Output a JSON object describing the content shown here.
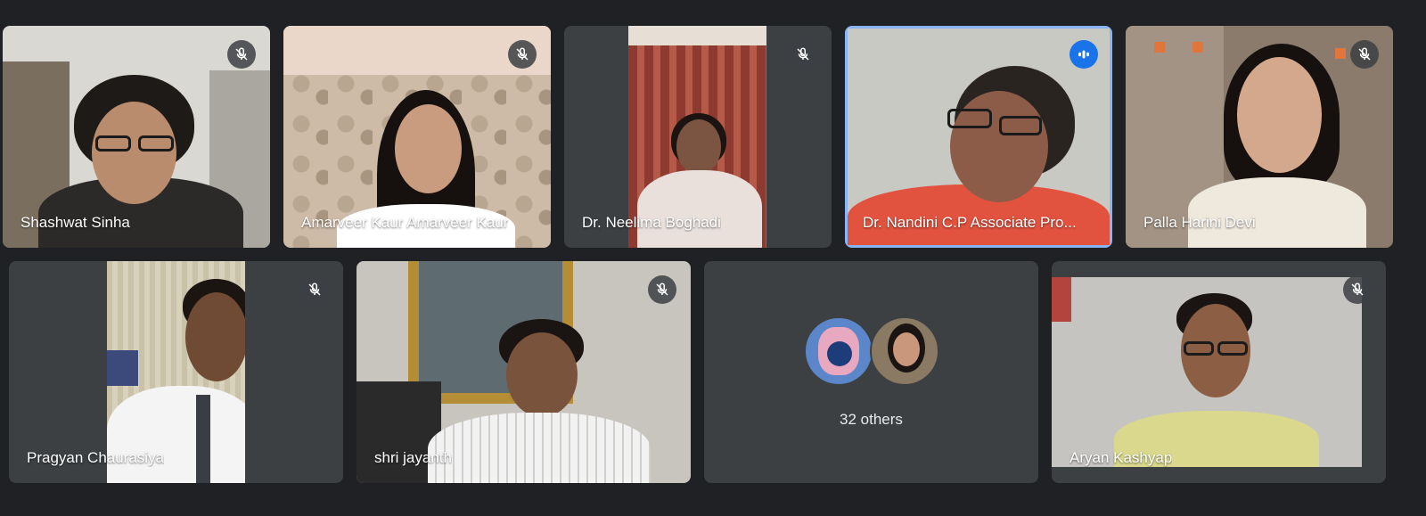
{
  "participants": [
    {
      "name": "Shashwat Sinha",
      "mic": "muted"
    },
    {
      "name": "Amarveer Kaur Amarveer Kaur",
      "mic": "muted"
    },
    {
      "name": "Dr. Neelima Boghadi",
      "mic": "muted"
    },
    {
      "name": "Dr. Nandini C.P Associate Pro...",
      "mic": "speaking"
    },
    {
      "name": "Palla Harini Devi",
      "mic": "muted"
    },
    {
      "name": "Pragyan Chaurasiya",
      "mic": "muted"
    },
    {
      "name": "shri jayanth",
      "mic": "muted"
    },
    {
      "name": "Aryan Kashyap",
      "mic": "muted"
    }
  ],
  "others": {
    "label": "32 others"
  },
  "icons": {
    "muted": "mic-off-icon",
    "speaking": "audio-level-icon"
  },
  "colors": {
    "background": "#202124",
    "tile": "#3c4043",
    "active_border": "#8ab4f8",
    "speaking": "#1a73e8"
  }
}
